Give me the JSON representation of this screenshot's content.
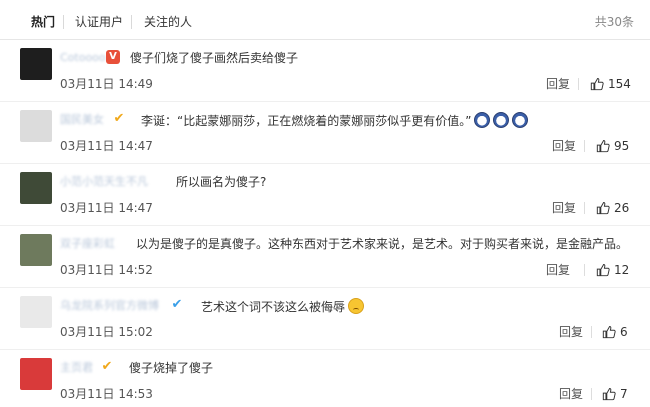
{
  "tabs": [
    {
      "label": "热门"
    },
    {
      "label": "认证用户"
    },
    {
      "label": "关注的人"
    }
  ],
  "total_label": "共30条",
  "reply_label": "回复",
  "comments": [
    {
      "text": "傻子们烧了傻子画然后卖给傻子",
      "time": "03月11日 14:49",
      "likes": "154",
      "avatar_color": "#1e1e1e"
    },
    {
      "text": "李诞：“比起蒙娜丽莎，正在燃烧着的蒙娜丽莎似乎更有价值。”",
      "time": "03月11日 14:47",
      "likes": "95",
      "avatar_color": "#dcdcdc"
    },
    {
      "text": "所以画名为傻子?",
      "time": "03月11日 14:47",
      "likes": "26",
      "avatar_color": "#3f4a37"
    },
    {
      "text": "以为是傻子的是真傻子。这种东西对于艺术家来说，是艺术。对于购买者来说，是金融产品。",
      "time": "03月11日 14:52",
      "likes": "12",
      "avatar_color": "#6e7a5d"
    },
    {
      "text": "艺术这个词不该这么被侮辱",
      "time": "03月11日 15:02",
      "likes": "6",
      "avatar_color": "#e9e9e9"
    },
    {
      "text": "傻子烧掉了傻子",
      "time": "03月11日 14:53",
      "likes": "7",
      "avatar_color": "#d93a3a"
    }
  ],
  "icons": {
    "like": "thumbs-up-icon",
    "emoji_rabbit": "rabbit-emoji-icon",
    "emoji_cry": "crying-emoji-icon"
  }
}
